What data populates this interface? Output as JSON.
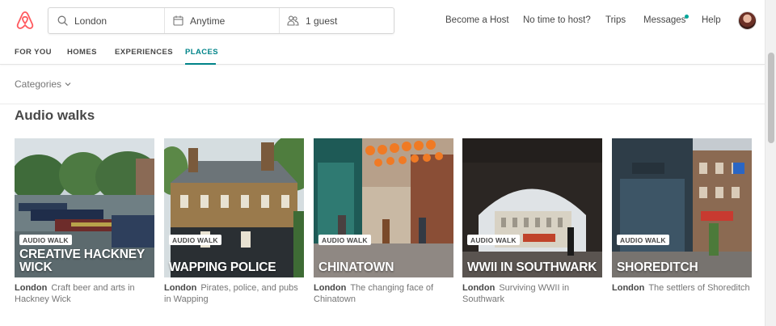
{
  "header": {
    "logo": "airbnb-logo",
    "search": {
      "location": "London",
      "dates": "Anytime",
      "guests": "1 guest",
      "location_icon": "search-icon",
      "dates_icon": "calendar-icon",
      "guests_icon": "guests-icon"
    },
    "nav": {
      "become_host": "Become a Host",
      "no_time": "No time to host?",
      "trips": "Trips",
      "messages": "Messages",
      "help": "Help"
    },
    "message_dot_color": "#00a699"
  },
  "tabs": [
    {
      "label": "FOR YOU",
      "active": false
    },
    {
      "label": "HOMES",
      "active": false
    },
    {
      "label": "EXPERIENCES",
      "active": false
    },
    {
      "label": "PLACES",
      "active": true
    }
  ],
  "accent_color": "#008489",
  "brand_color": "#ff5a5f",
  "categories_label": "Categories",
  "section_title": "Audio walks",
  "cards": [
    {
      "badge": "AUDIO WALK",
      "title": "CREATIVE HACKNEY WICK",
      "city": "London",
      "description": "Craft beer and arts in Hackney Wick"
    },
    {
      "badge": "AUDIO WALK",
      "title": "WAPPING POLICE",
      "city": "London",
      "description": "Pirates, police, and pubs in Wapping"
    },
    {
      "badge": "AUDIO WALK",
      "title": "CHINATOWN",
      "city": "London",
      "description": "The changing face of Chinatown"
    },
    {
      "badge": "AUDIO WALK",
      "title": "WWII IN SOUTHWARK",
      "city": "London",
      "description": "Surviving WWII in Southwark"
    },
    {
      "badge": "AUDIO WALK",
      "title": "SHOREDITCH",
      "city": "London",
      "description": "The settlers of Shoreditch"
    }
  ]
}
